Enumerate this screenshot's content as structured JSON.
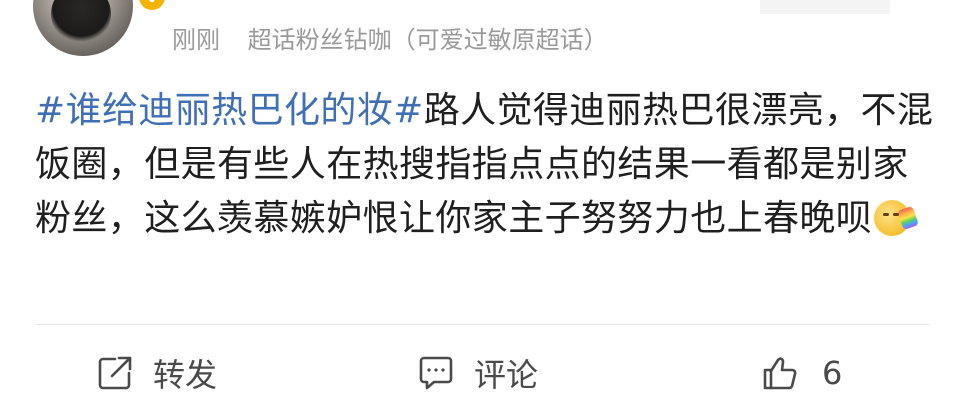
{
  "header": {
    "time": "刚刚",
    "source": "超话粉丝钻咖（可爱过敏原超话）",
    "verified_badge": "V",
    "avatar_icon": "avatar",
    "badge_color": "#f5b301"
  },
  "post": {
    "topic": "#谁给迪丽热巴化的妆#",
    "body": "路人觉得迪丽热巴很漂亮，不混饭圈，但是有些人在热搜指指点点的结果一看都是别家粉丝，这么羡慕嫉妒恨让你家主子努努力也上春晚呗",
    "emoji_icon": "rainbow-vomit-emoji",
    "topic_color": "#3f6fb5",
    "text_color": "#1f1f1f"
  },
  "actions": {
    "repost_label": "转发",
    "repost_icon": "share-icon",
    "comment_label": "评论",
    "comment_icon": "comment-icon",
    "like_count": "6",
    "like_icon": "thumbs-up-icon"
  }
}
